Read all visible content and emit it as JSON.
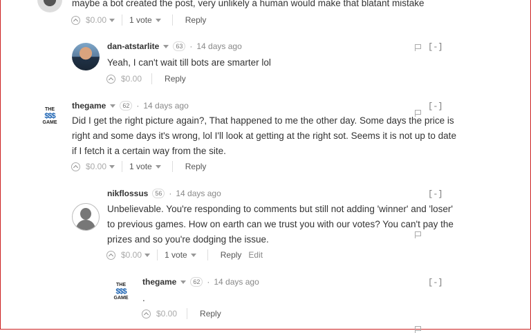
{
  "comments": [
    {
      "body": "maybe a bot created the post, very unlikely a human would make that blatant mistake",
      "payout": "$0.00",
      "votes": "1 vote",
      "reply": "Reply"
    },
    {
      "author": "dan-atstarlite",
      "rep": "63",
      "time": "14 days ago",
      "body": "Yeah, I can't wait till bots are smarter lol",
      "payout": "$0.00",
      "reply": "Reply",
      "collapse": "[-]"
    },
    {
      "author": "thegame",
      "rep": "62",
      "time": "14 days ago",
      "body_lines": [
        "Did I get the right picture again?, That happened to me the other day. Some days the price is",
        "right and some days it's wrong, lol I'll look at getting at the right sot. Seems it is not up to date",
        "if I fetch it a certain way from the site."
      ],
      "payout": "$0.00",
      "votes": "1 vote",
      "reply": "Reply",
      "collapse": "[-]",
      "logo": {
        "top": "THE",
        "mid": "$$$",
        "bottom": "GAME"
      }
    },
    {
      "author": "nikflossus",
      "rep": "56",
      "time": "14 days ago",
      "body_lines": [
        "Unbelievable. You're responding to comments but still not adding 'winner' and 'loser'",
        "to previous games. How on earth can we trust you with our votes? You can't pay the",
        "prizes and so you're dodging the issue."
      ],
      "payout": "$0.00",
      "votes": "1 vote",
      "reply": "Reply",
      "edit": "Edit",
      "collapse": "[-]"
    },
    {
      "author": "thegame",
      "rep": "62",
      "time": "14 days ago",
      "body": ".",
      "payout": "$0.00",
      "reply": "Reply",
      "collapse": "[-]",
      "logo": {
        "top": "THE",
        "mid": "$$$",
        "bottom": "GAME"
      }
    }
  ],
  "separator": "·"
}
